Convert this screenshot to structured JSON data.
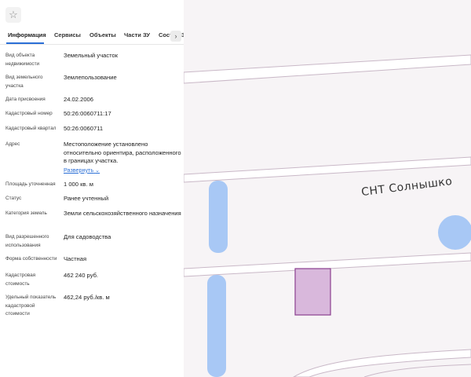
{
  "tabs": [
    "Информация",
    "Сервисы",
    "Объекты",
    "Части ЗУ",
    "Сост"
  ],
  "tab_overflow_clip": "З",
  "fields": [
    {
      "label": "Вид объекта недвижимости",
      "value": "Земельный участок"
    },
    {
      "label": "Вид земельного участка",
      "value": "Землепользование"
    },
    {
      "label": "Дата присвоения",
      "value": "24.02.2006"
    },
    {
      "label": "Кадастровый номер",
      "value": "50:26:0060711:17"
    },
    {
      "label": "Кадастровый квартал",
      "value": "50:26:0060711"
    },
    {
      "label": "Адрес",
      "value": "Местоположение установлено относительно ориентира, расположенного в границах участка.",
      "link": "Развернуть"
    },
    {
      "label": "Площадь уточненная",
      "value": "1 000 кв. м"
    },
    {
      "label": "Статус",
      "value": "Ранее учтенный"
    },
    {
      "label": "Категория земель",
      "value": "Земли сельскохозяйственного назначения"
    },
    {
      "label": "Вид разрешенного использования",
      "value": "Для садоводства"
    },
    {
      "label": "Форма собственности",
      "value": "Частная"
    },
    {
      "label": "Кадастровая стоимость",
      "value": "462 240 руб."
    },
    {
      "label": "Удельный показатель кадастровой стоимости",
      "value": "462,24 руб./кв. м"
    }
  ],
  "map": {
    "label": "СНТ Солнышко",
    "colors": {
      "background": "#f7f4f6",
      "road_fill": "#ffffff",
      "road_border": "#c9b8c7",
      "water": "#a8c8f5",
      "parcel_fill": "#d9b8dc",
      "parcel_border": "#8a3f8f"
    }
  },
  "icons": {
    "favorite": "star-icon",
    "tabs_scroll": "chevron-right-icon",
    "expand": "chevron-down-icon"
  },
  "accent_color": "#2b6fd6"
}
